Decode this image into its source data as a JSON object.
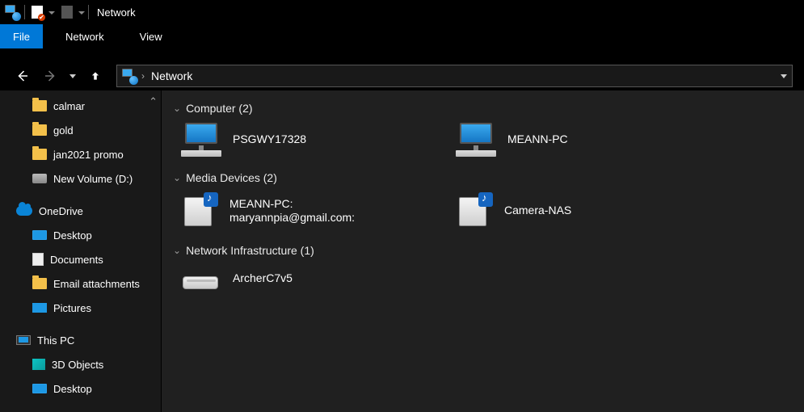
{
  "title": "Network",
  "ribbon": {
    "file": "File",
    "tabs": [
      "Network",
      "View"
    ]
  },
  "address": {
    "crumb": "Network"
  },
  "sidebar": {
    "items": [
      {
        "icon": "folder",
        "label": "calmar",
        "indent": 1
      },
      {
        "icon": "folder",
        "label": "gold",
        "indent": 1
      },
      {
        "icon": "folder",
        "label": "jan2021 promo",
        "indent": 1
      },
      {
        "icon": "drive",
        "label": "New Volume (D:)",
        "indent": 1
      }
    ],
    "onedrive": {
      "label": "OneDrive"
    },
    "onedrive_children": [
      {
        "icon": "monitor",
        "label": "Desktop"
      },
      {
        "icon": "doc",
        "label": "Documents"
      },
      {
        "icon": "folder",
        "label": "Email attachments"
      },
      {
        "icon": "pic",
        "label": "Pictures"
      }
    ],
    "thispc": {
      "label": "This PC"
    },
    "thispc_children": [
      {
        "icon": "cube",
        "label": "3D Objects"
      },
      {
        "icon": "monitor",
        "label": "Desktop"
      }
    ]
  },
  "content": {
    "groups": [
      {
        "title": "Computer",
        "count": 2,
        "kind": "computer",
        "items": [
          {
            "label": "PSGWY17328"
          },
          {
            "label": "MEANN-PC"
          }
        ]
      },
      {
        "title": "Media Devices",
        "count": 2,
        "kind": "media",
        "items": [
          {
            "label": "MEANN-PC:",
            "sub": "maryannpia@gmail.com:"
          },
          {
            "label": "Camera-NAS"
          }
        ]
      },
      {
        "title": "Network Infrastructure",
        "count": 1,
        "kind": "router",
        "items": [
          {
            "label": "ArcherC7v5"
          }
        ]
      }
    ]
  }
}
